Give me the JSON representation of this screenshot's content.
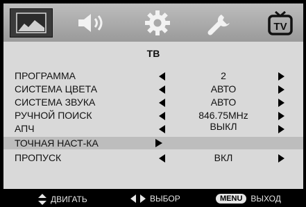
{
  "tabs": [
    {
      "id": "picture",
      "icon": "picture-icon"
    },
    {
      "id": "sound",
      "icon": "speaker-icon"
    },
    {
      "id": "setup",
      "icon": "gear-icon"
    },
    {
      "id": "features",
      "icon": "wrench-icon"
    },
    {
      "id": "tv",
      "icon": "tv-icon",
      "active": true
    }
  ],
  "title": "ТВ",
  "menu": {
    "items": [
      {
        "label": "ПРОГРАММА",
        "value": "2"
      },
      {
        "label": "СИСТЕМА ЦВЕТА",
        "value": "АВТО"
      },
      {
        "label": "СИСТЕМА ЗВУКА",
        "value": "АВТО"
      },
      {
        "label": "РУЧНОЙ ПОИСК",
        "value": "846.75MHz"
      },
      {
        "label": "АПЧ",
        "value": "ВЫКЛ"
      },
      {
        "label": "ТОЧНАЯ НАСТ-КА",
        "value": ""
      },
      {
        "label": "ПРОПУСК",
        "value": "ВКЛ"
      }
    ]
  },
  "footer": {
    "move_label": "ДВИГАТЬ",
    "select_label": "ВЫБОР",
    "menu_key": "MENU",
    "exit_label": "ВЫХОД"
  },
  "colors": {
    "panel_bg": "#d9d9d9",
    "selected_row": "#bdbdbd",
    "footer_bg": "#000000"
  }
}
